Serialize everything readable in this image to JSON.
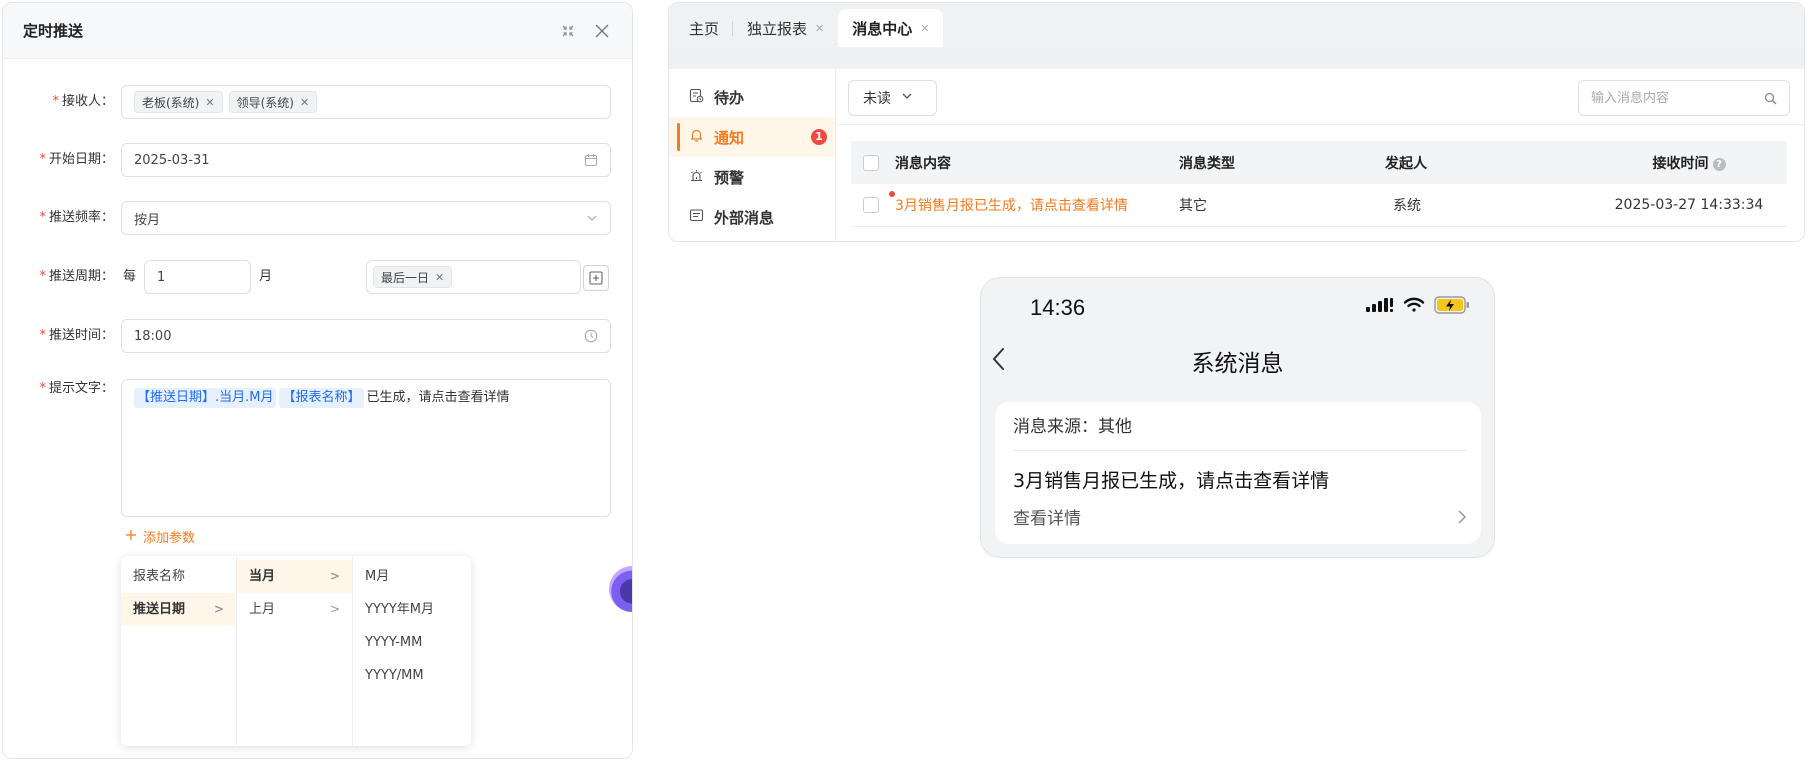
{
  "dialog": {
    "title": "定时推送",
    "fields": {
      "recipients": {
        "label": "接收人：",
        "tags": [
          "老板(系统)",
          "领导(系统)"
        ]
      },
      "start_date": {
        "label": "开始日期：",
        "value": "2025-03-31"
      },
      "frequency": {
        "label": "推送频率：",
        "value": "按月"
      },
      "period": {
        "label": "推送周期：",
        "prefix": "每",
        "number": "1",
        "unit": "月",
        "day_tag": "最后一日"
      },
      "time": {
        "label": "推送时间：",
        "value": "18:00"
      },
      "prompt": {
        "label": "提示文字：",
        "chip1": "【推送日期】.当月.M月",
        "chip2": "【报表名称】",
        "text": "已生成，请点击查看详情"
      }
    },
    "required_mark": "*",
    "add_param": "添加参数",
    "cascader": {
      "col1": [
        "报表名称",
        "推送日期"
      ],
      "col2": [
        "当月",
        "上月"
      ],
      "col3": [
        "M月",
        "YYYY年M月",
        "YYYY-MM",
        "YYYY/MM"
      ]
    }
  },
  "message_center": {
    "tabs": [
      "主页",
      "独立报表",
      "消息中心"
    ],
    "side_nav": [
      {
        "label": "待办",
        "icon": "todo-icon"
      },
      {
        "label": "通知",
        "icon": "bell-icon",
        "badge": "1"
      },
      {
        "label": "预警",
        "icon": "alarm-icon"
      },
      {
        "label": "外部消息",
        "icon": "message-icon"
      }
    ],
    "filter": {
      "status": "未读",
      "search_placeholder": "输入消息内容"
    },
    "table": {
      "headers": [
        "消息内容",
        "消息类型",
        "发起人",
        "接收时间"
      ],
      "rows": [
        {
          "content": "3月销售月报已生成，请点击查看详情",
          "type": "其它",
          "sender": "系统",
          "time": "2025-03-27 14:33:34"
        }
      ]
    },
    "accent": "#f57b1f"
  },
  "phone": {
    "time": "14:36",
    "title": "系统消息",
    "source": "消息来源：其他",
    "message": "3月销售月报已生成，请点击查看详情",
    "detail": "查看详情"
  }
}
